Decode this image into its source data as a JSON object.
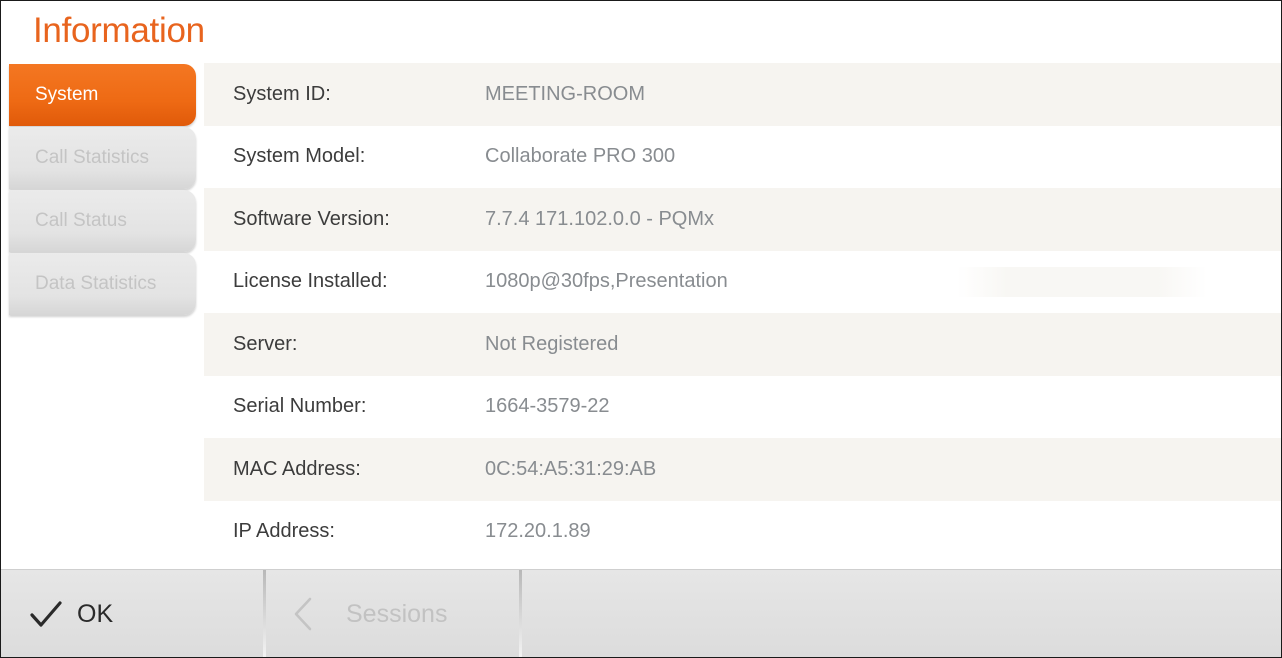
{
  "header": {
    "title": "Information"
  },
  "sidebar": {
    "tabs": [
      {
        "label": "System",
        "active": true
      },
      {
        "label": "Call Statistics",
        "active": false
      },
      {
        "label": "Call Status",
        "active": false
      },
      {
        "label": "Data Statistics",
        "active": false
      }
    ]
  },
  "system_info": {
    "rows": [
      {
        "label": "System ID:",
        "value": "MEETING-ROOM"
      },
      {
        "label": "System Model:",
        "value": "Collaborate PRO 300"
      },
      {
        "label": "Software Version:",
        "value": "7.7.4  171.102.0.0 - PQMx"
      },
      {
        "label": "License Installed:",
        "value": "1080p@30fps,Presentation"
      },
      {
        "label": "Server:",
        "value": "Not Registered"
      },
      {
        "label": "Serial Number:",
        "value": "1664-3579-22"
      },
      {
        "label": "MAC Address:",
        "value": "0C:54:A5:31:29:AB"
      },
      {
        "label": "IP Address:",
        "value": "172.20.1.89"
      }
    ]
  },
  "footer": {
    "ok_label": "OK",
    "sessions_label": "Sessions",
    "ok_icon": "check-icon",
    "sessions_icon": "chevron-left-icon"
  },
  "colors": {
    "accent": "#ee6a14",
    "title": "#e8641e",
    "label_text": "#3c3c3c",
    "value_text": "#888c90",
    "inactive_tab_text": "#c4c4c4",
    "row_alt": "#f6f4f0"
  }
}
